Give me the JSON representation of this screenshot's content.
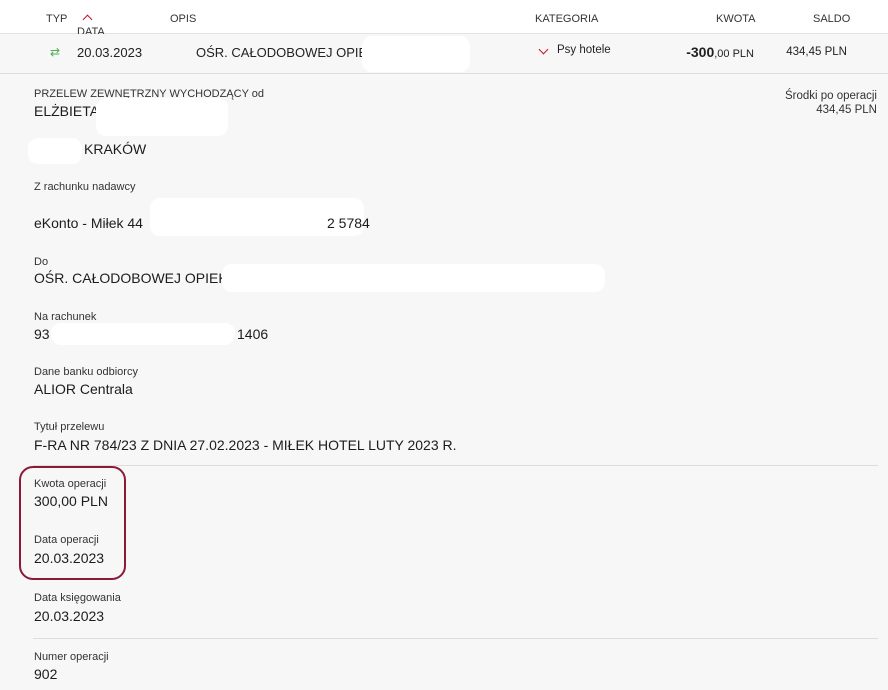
{
  "header": {
    "type": "TYP",
    "date": "DATA",
    "description": "OPIS",
    "category": "KATEGORIA",
    "amount": "KWOTA",
    "balance": "SALDO"
  },
  "transaction": {
    "type_icon": "transfer-arrows-icon",
    "date": "20.03.2023",
    "description": "OŚR. CAŁODOBOWEJ OPIEKI",
    "category": "Psy hotele",
    "amount_main": "-300",
    "amount_rest": ",00 PLN",
    "balance": "434,45 PLN"
  },
  "details": {
    "transfer_type_label": "PRZELEW ZEWNĘTRZNY WYCHODZĄCY od",
    "sender_name": "ELŻBIETA",
    "sender_city": "KRAKÓW",
    "after_balance_label": "Środki po operacji",
    "after_balance_value": "434,45 PLN",
    "from_account_label": "Z rachunku nadawcy",
    "from_account_prefix": "eKonto - Miłek 44",
    "from_account_suffix": "2 5784",
    "to_label": "Do",
    "to_value": "OŚR. CAŁODOBOWEJ OPIEKI",
    "to_account_label": "Na rachunek",
    "to_account_prefix": "93",
    "to_account_suffix": "1406",
    "bank_label": "Dane banku odbiorcy",
    "bank_value": "ALIOR Centrala",
    "title_label": "Tytuł przelewu",
    "title_value": "F-RA NR 784/23 Z DNIA 27.02.2023 - MIŁEK HOTEL LUTY 2023 R.",
    "op_amount_label": "Kwota operacji",
    "op_amount_value": "300,00 PLN",
    "op_date_label": "Data operacji",
    "op_date_value": "20.03.2023",
    "booking_date_label": "Data księgowania",
    "booking_date_value": "20.03.2023",
    "op_number_label": "Numer operacji",
    "op_number_value": "902"
  },
  "colors": {
    "accent": "#c8102e",
    "highlight_border": "#8b1a3a",
    "transfer_icon": "#4caf50"
  }
}
